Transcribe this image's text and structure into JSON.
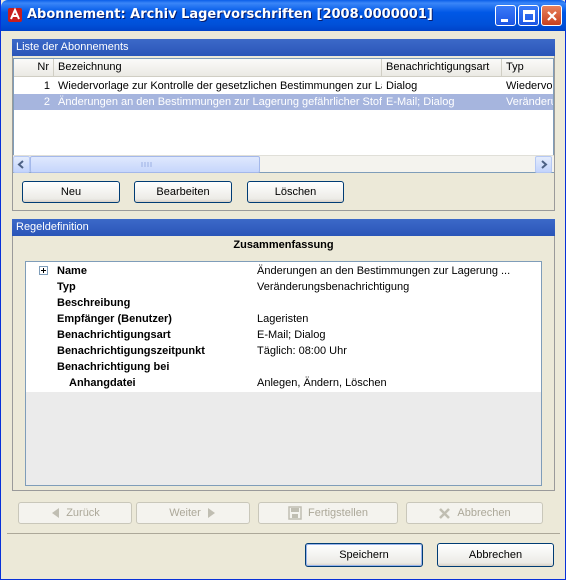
{
  "window": {
    "title": "Abonnement: Archiv Lagervorschriften [2008.0000001]"
  },
  "subscriptions": {
    "header": "Liste der Abonnements",
    "columns": [
      "Nr",
      "Bezeichnung",
      "Benachrichtigungsart",
      "Typ"
    ],
    "rows": [
      {
        "nr": "1",
        "bezeichnung": "Wiedervorlage zur Kontrolle der gesetzlichen Bestimmungen zur Lagerung",
        "art": "Dialog",
        "typ": "Wiedervorlage"
      },
      {
        "nr": "2",
        "bezeichnung": "Änderungen an den Bestimmungen zur Lagerung gefährlicher Stoffe",
        "art": "E-Mail; Dialog",
        "typ": "Veränderungsbenachrichtigung"
      }
    ],
    "buttons": {
      "new": "Neu",
      "edit": "Bearbeiten",
      "delete": "Löschen"
    }
  },
  "rule_definition": {
    "header": "Regeldefinition",
    "summary_title": "Zusammenfassung",
    "items": [
      {
        "key": "Name",
        "value": "Änderungen an den Bestimmungen zur Lagerung ..."
      },
      {
        "key": "Typ",
        "value": "Veränderungsbenachrichtigung"
      },
      {
        "key": "Beschreibung",
        "value": ""
      },
      {
        "key": "Empfänger (Benutzer)",
        "value": "Lageristen"
      },
      {
        "key": "Benachrichtigungsart",
        "value": "E-Mail; Dialog"
      },
      {
        "key": "Benachrichtigungszeitpunkt",
        "value": "Täglich: 08:00 Uhr"
      },
      {
        "key": "Benachrichtigung bei",
        "value": ""
      },
      {
        "key": "Anhangdatei",
        "value": "Anlegen, Ändern, Löschen"
      }
    ]
  },
  "wizard": {
    "back": "Zurück",
    "next": "Weiter",
    "finish": "Fertigstellen",
    "abort": "Abbrechen"
  },
  "dialog": {
    "save": "Speichern",
    "cancel": "Abbrechen"
  },
  "colors": {
    "titlebar": "#0058e6",
    "group_header": "#2f5cbf",
    "selection": "#a6b5de"
  }
}
